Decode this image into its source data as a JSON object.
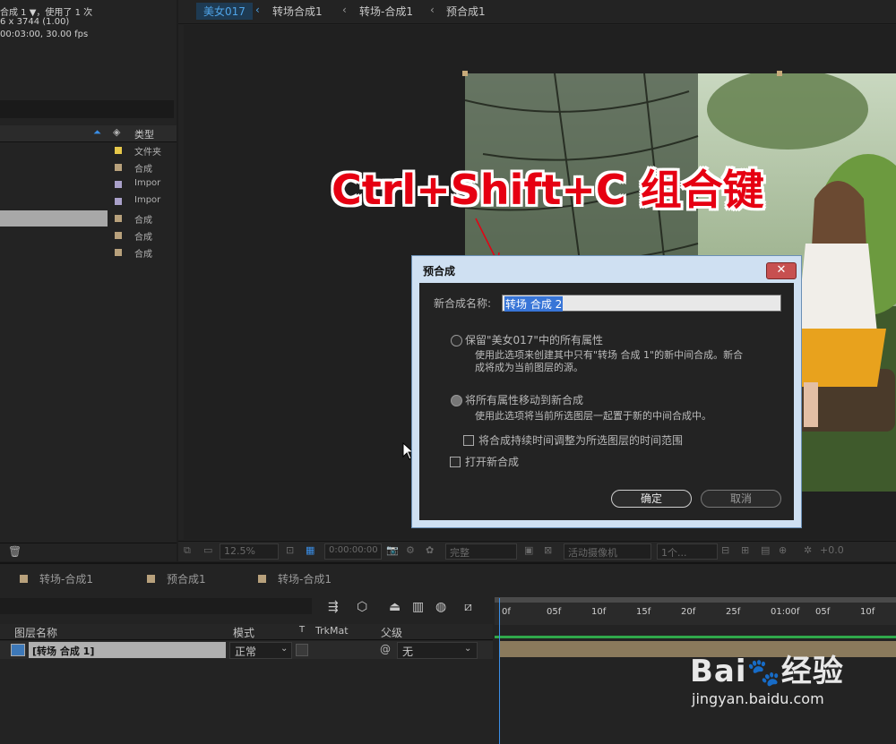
{
  "project": {
    "info_line1": "合成 1 ▼，使用了 1 次",
    "info_line2": "6 x 3744 (1.00)",
    "info_line3": "00:03:00, 30.00 fps",
    "type_header": "类型",
    "rows": [
      {
        "color": "#e6c84a",
        "type": "文件夹"
      },
      {
        "color": "#b8a17c",
        "type": "合成"
      },
      {
        "color": "#a9a0c9",
        "type": "Impor"
      },
      {
        "color": "#a9a0c9",
        "type": "Impor"
      },
      {
        "color": "#b8a17c",
        "type": "合成",
        "selected": true
      },
      {
        "color": "#b8a17c",
        "type": "合成"
      },
      {
        "color": "#b8a17c",
        "type": "合成"
      }
    ]
  },
  "breadcrumb": {
    "items": [
      "美女017",
      "转场合成1",
      "转场-合成1",
      "预合成1"
    ],
    "separator": "‹"
  },
  "overlay": {
    "shortcut_text": "Ctrl+Shift+C 组合键"
  },
  "viewer_bar": {
    "zoom": "12.5%",
    "timecode": "0:00:00:00",
    "resolution": "完整",
    "camera": "活动摄像机",
    "views": "1个...",
    "exposure": "+0.0"
  },
  "dialog": {
    "title": "预合成",
    "name_label": "新合成名称:",
    "name_value": "转场 合成 2",
    "option1_label": "保留\"美女017\"中的所有属性",
    "option1_desc1": "使用此选项来创建其中只有\"转场 合成 1\"的新中间合成。新合",
    "option1_desc2": "成将成为当前图层的源。",
    "option2_label": "将所有属性移动到新合成",
    "option2_desc": "使用此选项将当前所选图层一起置于新的中间合成中。",
    "adjust_duration_label": "将合成持续时间调整为所选图层的时间范围",
    "open_new_label": "打开新合成",
    "ok_label": "确定",
    "cancel_label": "取消"
  },
  "timeline": {
    "tabs": [
      "转场-合成1",
      "预合成1",
      "转场-合成1"
    ],
    "col_layer_name": "图层名称",
    "col_mode": "模式",
    "col_t": "T",
    "col_trkmat": "TrkMat",
    "col_parent": "父级",
    "layer_name": "[转场 合成 1]",
    "layer_mode": "正常",
    "layer_parent": "无",
    "ruler_ticks": [
      "0f",
      "05f",
      "10f",
      "15f",
      "20f",
      "25f",
      "01:00f",
      "05f",
      "10f"
    ]
  },
  "watermark": {
    "brand": "Bai",
    "brand2": "经验",
    "url": "jingyan.baidu.com"
  }
}
